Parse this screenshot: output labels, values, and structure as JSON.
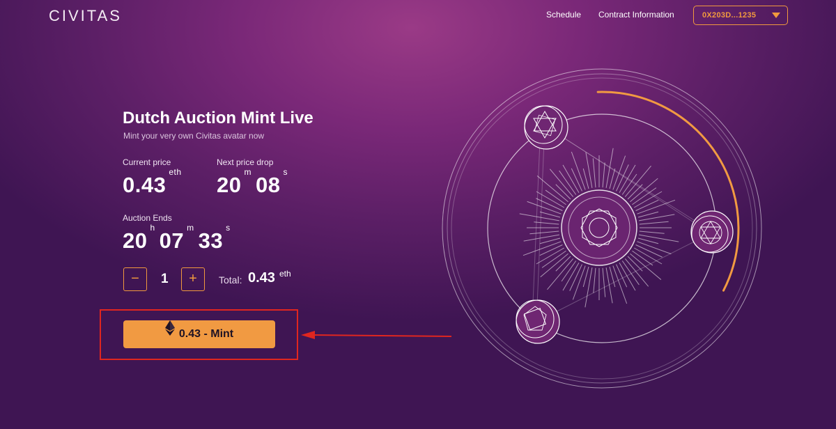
{
  "header": {
    "logo": "CIVITAS",
    "nav": {
      "schedule": "Schedule",
      "contract": "Contract Information"
    },
    "wallet": "0X203D...1235"
  },
  "auction": {
    "title": "Dutch Auction Mint Live",
    "subtitle": "Mint your very own Civitas avatar now",
    "current_price_label": "Current price",
    "current_price": "0.43",
    "current_price_unit": "eth",
    "next_drop_label": "Next price drop",
    "next_drop_min": "20",
    "next_drop_min_unit": "m",
    "next_drop_sec": "08",
    "next_drop_sec_unit": "s",
    "ends_label": "Auction Ends",
    "ends_h": "20",
    "ends_h_unit": "h",
    "ends_m": "07",
    "ends_m_unit": "m",
    "ends_s": "33",
    "ends_s_unit": "s"
  },
  "quantity": {
    "minus": "−",
    "value": "1",
    "plus": "+",
    "total_label": "Total:",
    "total_value": "0.43",
    "total_unit": "eth"
  },
  "mint_button": {
    "label": "0.43 - Mint",
    "icon": "ethereum-icon"
  },
  "colors": {
    "accent": "#f19a42",
    "annotation_red": "#e0261f",
    "background": "#6a2470"
  },
  "progress": {
    "ring_fraction": 0.33
  }
}
